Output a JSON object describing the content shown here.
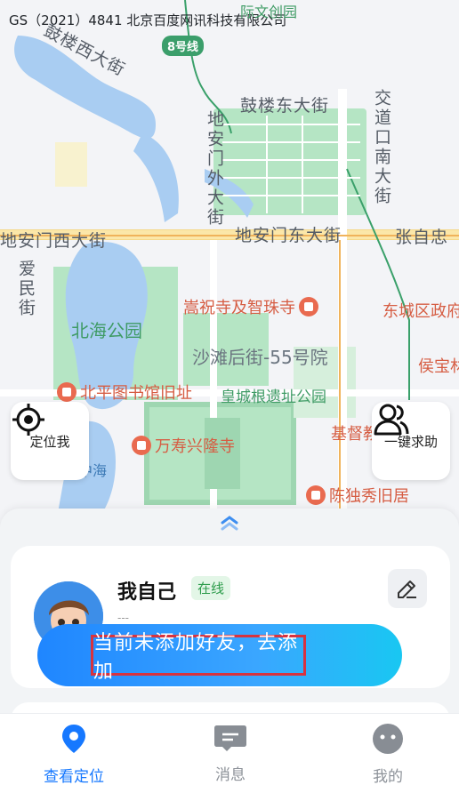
{
  "map": {
    "copyright": "GS（2021）4841 北京百度网讯科技有限公司",
    "metro_line": "8号线",
    "streets": {
      "gulou_west": "鼓楼西大街",
      "gulou_east": "鼓楼东大街",
      "jiaodaokou_south": "交道口南大街",
      "dianmen_outer": "地安门外大街",
      "dianmen_west": "地安门西大街",
      "dianmen_east": "地安门东大街",
      "zhangzizhong": "张自忠",
      "aimin": "爱民街"
    },
    "parks": {
      "beihai": "北海公园",
      "huangcheng": "皇城根遗址公园",
      "shatan": "沙滩后街-55号院"
    },
    "pois": {
      "songzhusi": "嵩祝寺及智珠寺",
      "dongcheng_gov": "东城区政府",
      "houbao": "侯宝林",
      "library": "北平图书馆旧址",
      "wanshou": "万寿兴隆寺",
      "jidujiao": "基督教",
      "chenduxiu": "陈独秀旧居",
      "culture_park": "际文创园"
    },
    "hai": "中海"
  },
  "buttons": {
    "locate_me": "定位我",
    "sos": "一键求助"
  },
  "card": {
    "name": "我自己",
    "status": "在线",
    "subtitle": "---",
    "add_friend_prompt": "当前未添加好友，去添加"
  },
  "tabs": [
    {
      "label": "查看定位",
      "icon": "location-pin-icon",
      "active": true
    },
    {
      "label": "消息",
      "icon": "message-icon",
      "active": false
    },
    {
      "label": "我的",
      "icon": "profile-icon",
      "active": false
    }
  ],
  "colors": {
    "accent": "#1678ff",
    "online": "#2e9c4c",
    "highlight_border": "#d7333f"
  }
}
